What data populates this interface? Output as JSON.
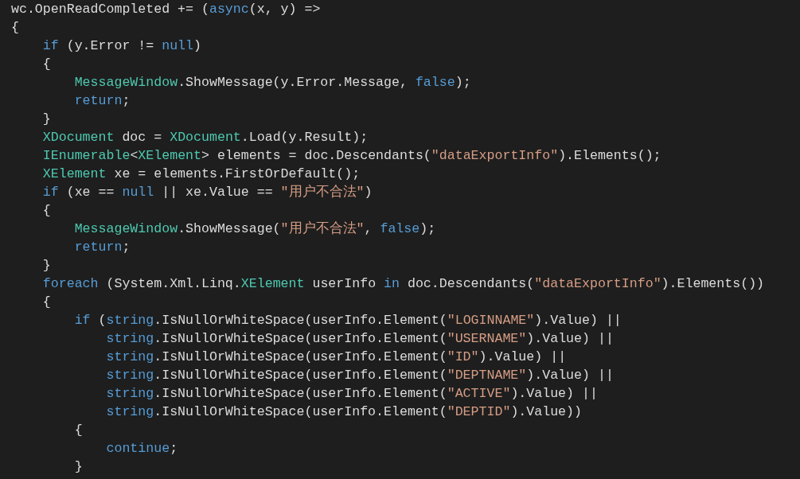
{
  "code_lines": [
    [
      {
        "kind": "plain",
        "text": "wc.OpenReadCompleted += ("
      },
      {
        "kind": "keyword",
        "text": "async"
      },
      {
        "kind": "plain",
        "text": "(x, y) =>"
      }
    ],
    [
      {
        "kind": "plain",
        "text": "{"
      }
    ],
    [
      {
        "kind": "keyword",
        "text": "    if"
      },
      {
        "kind": "plain",
        "text": " (y.Error != "
      },
      {
        "kind": "keyword",
        "text": "null"
      },
      {
        "kind": "plain",
        "text": ")"
      }
    ],
    [
      {
        "kind": "plain",
        "text": "    {"
      }
    ],
    [
      {
        "kind": "type",
        "text": "        MessageWindow"
      },
      {
        "kind": "plain",
        "text": ".ShowMessage(y.Error.Message, "
      },
      {
        "kind": "keyword",
        "text": "false"
      },
      {
        "kind": "plain",
        "text": ");"
      }
    ],
    [
      {
        "kind": "keyword",
        "text": "        return"
      },
      {
        "kind": "plain",
        "text": ";"
      }
    ],
    [
      {
        "kind": "plain",
        "text": "    }"
      }
    ],
    [
      {
        "kind": "type",
        "text": "    XDocument"
      },
      {
        "kind": "plain",
        "text": " doc = "
      },
      {
        "kind": "type",
        "text": "XDocument"
      },
      {
        "kind": "plain",
        "text": ".Load(y.Result);"
      }
    ],
    [
      {
        "kind": "type",
        "text": "    IEnumerable"
      },
      {
        "kind": "plain",
        "text": "<"
      },
      {
        "kind": "type",
        "text": "XElement"
      },
      {
        "kind": "plain",
        "text": "> elements = doc.Descendants("
      },
      {
        "kind": "string",
        "text": "\"dataExportInfo\""
      },
      {
        "kind": "plain",
        "text": ").Elements();"
      }
    ],
    [
      {
        "kind": "type",
        "text": "    XElement"
      },
      {
        "kind": "plain",
        "text": " xe = elements.FirstOrDefault();"
      }
    ],
    [
      {
        "kind": "keyword",
        "text": "    if"
      },
      {
        "kind": "plain",
        "text": " (xe == "
      },
      {
        "kind": "keyword",
        "text": "null"
      },
      {
        "kind": "plain",
        "text": " || xe.Value == "
      },
      {
        "kind": "string",
        "text": "\"用户不合法\""
      },
      {
        "kind": "plain",
        "text": ")"
      }
    ],
    [
      {
        "kind": "plain",
        "text": "    {"
      }
    ],
    [
      {
        "kind": "type",
        "text": "        MessageWindow"
      },
      {
        "kind": "plain",
        "text": ".ShowMessage("
      },
      {
        "kind": "string",
        "text": "\"用户不合法\""
      },
      {
        "kind": "plain",
        "text": ", "
      },
      {
        "kind": "keyword",
        "text": "false"
      },
      {
        "kind": "plain",
        "text": ");"
      }
    ],
    [
      {
        "kind": "keyword",
        "text": "        return"
      },
      {
        "kind": "plain",
        "text": ";"
      }
    ],
    [
      {
        "kind": "plain",
        "text": "    }"
      }
    ],
    [
      {
        "kind": "keyword",
        "text": "    foreach"
      },
      {
        "kind": "plain",
        "text": " (System.Xml.Linq."
      },
      {
        "kind": "type",
        "text": "XElement"
      },
      {
        "kind": "plain",
        "text": " userInfo "
      },
      {
        "kind": "keyword",
        "text": "in"
      },
      {
        "kind": "plain",
        "text": " doc.Descendants("
      },
      {
        "kind": "string",
        "text": "\"dataExportInfo\""
      },
      {
        "kind": "plain",
        "text": ").Elements())"
      }
    ],
    [
      {
        "kind": "plain",
        "text": "    {"
      }
    ],
    [
      {
        "kind": "keyword",
        "text": "        if"
      },
      {
        "kind": "plain",
        "text": " ("
      },
      {
        "kind": "keyword",
        "text": "string"
      },
      {
        "kind": "plain",
        "text": ".IsNullOrWhiteSpace(userInfo.Element("
      },
      {
        "kind": "string",
        "text": "\"LOGINNAME\""
      },
      {
        "kind": "plain",
        "text": ").Value) ||"
      }
    ],
    [
      {
        "kind": "keyword",
        "text": "            string"
      },
      {
        "kind": "plain",
        "text": ".IsNullOrWhiteSpace(userInfo.Element("
      },
      {
        "kind": "string",
        "text": "\"USERNAME\""
      },
      {
        "kind": "plain",
        "text": ").Value) ||"
      }
    ],
    [
      {
        "kind": "keyword",
        "text": "            string"
      },
      {
        "kind": "plain",
        "text": ".IsNullOrWhiteSpace(userInfo.Element("
      },
      {
        "kind": "string",
        "text": "\"ID\""
      },
      {
        "kind": "plain",
        "text": ").Value) ||"
      }
    ],
    [
      {
        "kind": "keyword",
        "text": "            string"
      },
      {
        "kind": "plain",
        "text": ".IsNullOrWhiteSpace(userInfo.Element("
      },
      {
        "kind": "string",
        "text": "\"DEPTNAME\""
      },
      {
        "kind": "plain",
        "text": ").Value) ||"
      }
    ],
    [
      {
        "kind": "keyword",
        "text": "            string"
      },
      {
        "kind": "plain",
        "text": ".IsNullOrWhiteSpace(userInfo.Element("
      },
      {
        "kind": "string",
        "text": "\"ACTIVE\""
      },
      {
        "kind": "plain",
        "text": ").Value) ||"
      }
    ],
    [
      {
        "kind": "keyword",
        "text": "            string"
      },
      {
        "kind": "plain",
        "text": ".IsNullOrWhiteSpace(userInfo.Element("
      },
      {
        "kind": "string",
        "text": "\"DEPTID\""
      },
      {
        "kind": "plain",
        "text": ").Value))"
      }
    ],
    [
      {
        "kind": "plain",
        "text": "        {"
      }
    ],
    [
      {
        "kind": "keyword",
        "text": "            continue"
      },
      {
        "kind": "plain",
        "text": ";"
      }
    ],
    [
      {
        "kind": "plain",
        "text": "        }"
      }
    ]
  ]
}
